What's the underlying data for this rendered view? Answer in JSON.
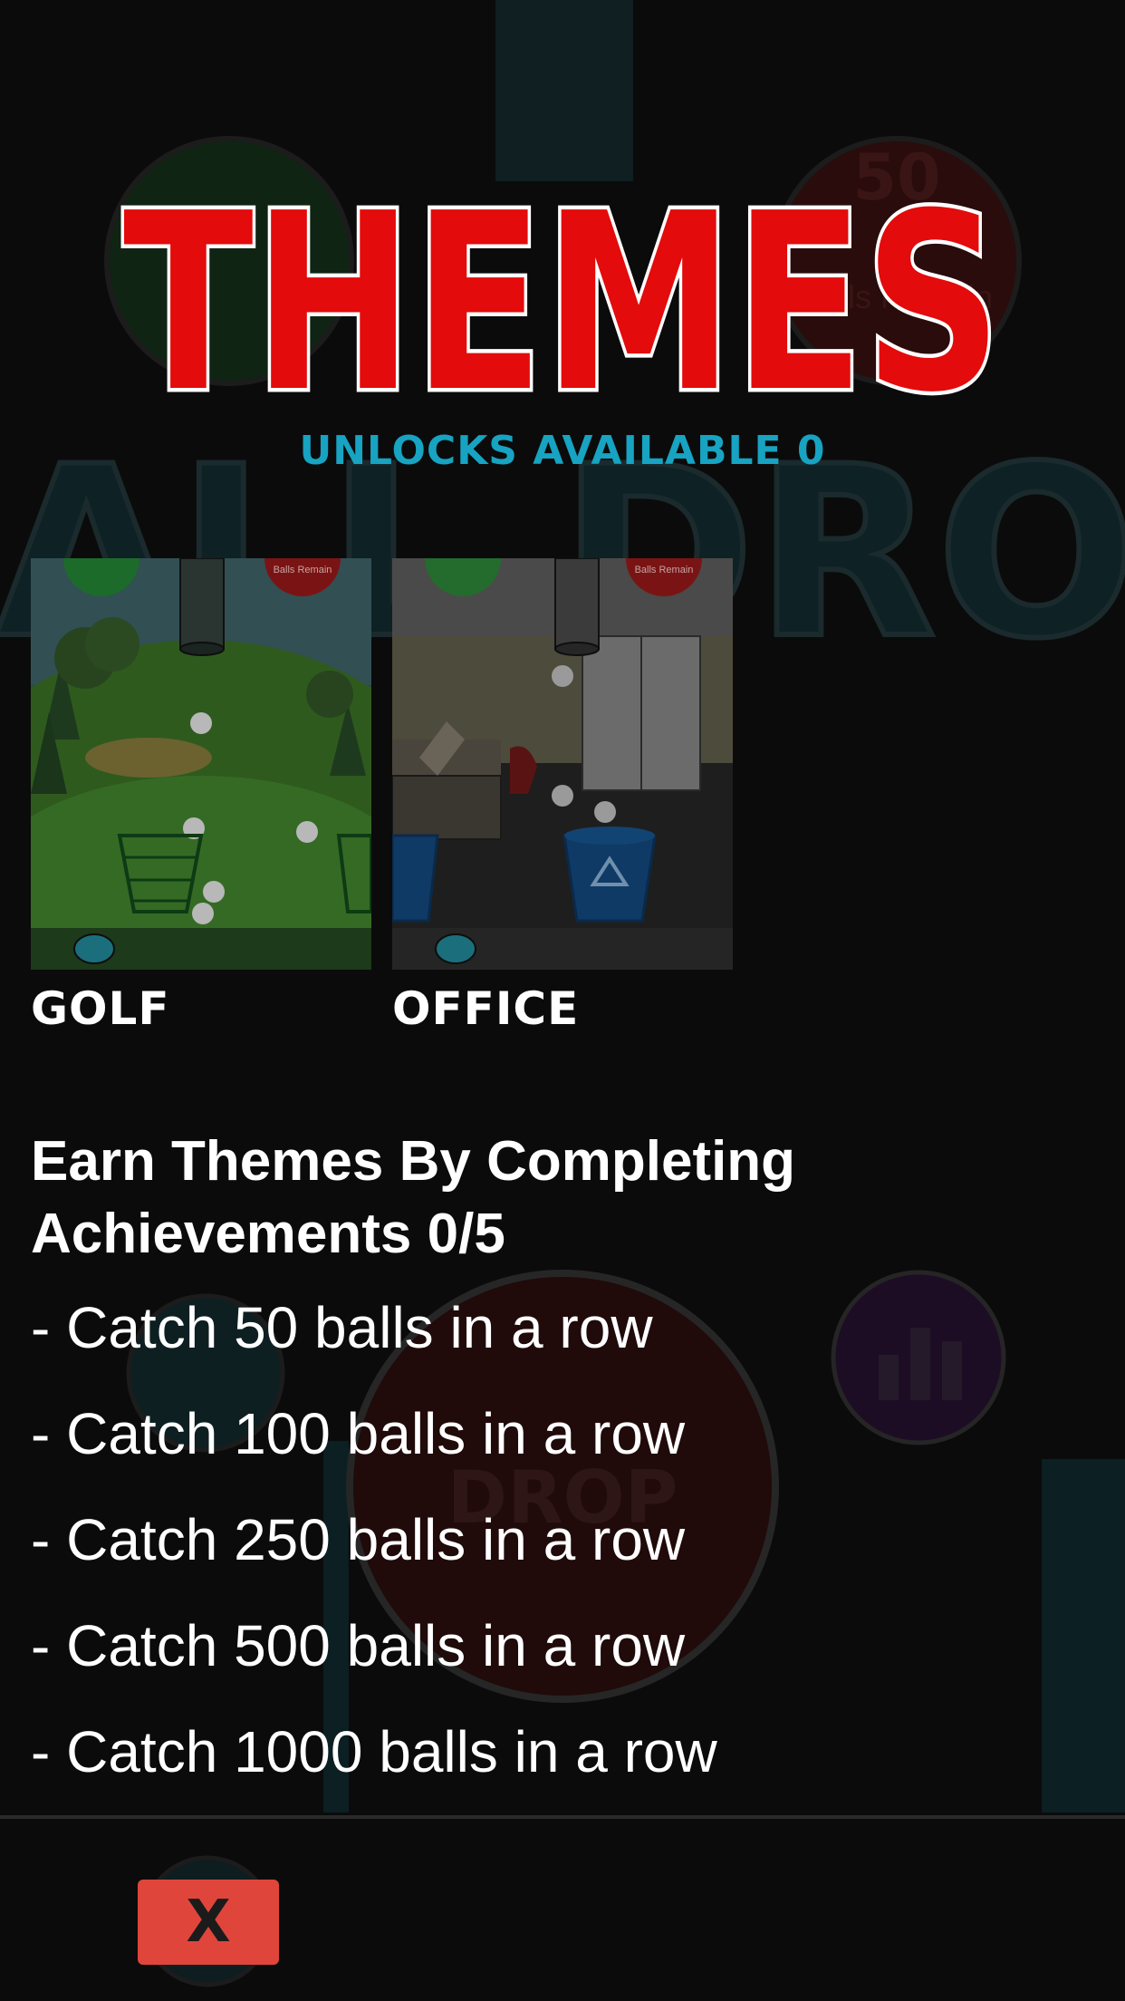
{
  "screen": {
    "title": "THEMES",
    "unlocks_label": "UNLOCKS AVAILABLE 0"
  },
  "themes": [
    {
      "id": "golf",
      "label": "GOLF",
      "hud_text": "Balls Remain"
    },
    {
      "id": "office",
      "label": "OFFICE",
      "hud_text": "Balls Remain"
    }
  ],
  "achievements": {
    "heading": "Earn Themes By Completing Achievements 0/5",
    "items": [
      "- Catch 50 balls in a row",
      "- Catch 100 balls in a row",
      "- Catch 250 balls in a row",
      "- Catch 500 balls in a row",
      "- Catch 1000 balls in a row"
    ]
  },
  "background": {
    "game_title": "BALL DROP",
    "drop_button": "DROP",
    "balls_count": "50",
    "balls_remain": "Balls Remain"
  },
  "footer": {
    "close_label": "X"
  },
  "colors": {
    "background": "#0b0b0b",
    "title_red": "#e30b0b",
    "accent_cyan": "#17a3c1",
    "close_button": "#e0453c"
  }
}
